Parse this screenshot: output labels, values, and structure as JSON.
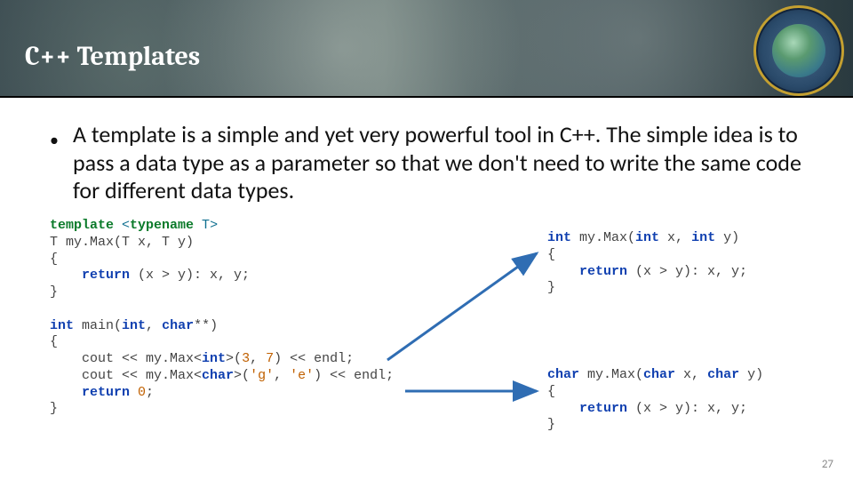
{
  "header": {
    "title": "C++ Templates"
  },
  "bullet": {
    "text": "A template is a simple and yet very powerful tool in C++. The simple idea is to pass a data type as a parameter so that we don't need to write the same code for different data types."
  },
  "code": {
    "left": {
      "l1a": "template ",
      "l1b": "<",
      "l1c": "typename ",
      "l1d": "T",
      "l1e": ">",
      "l2a": "T ",
      "l2b": "my.Max",
      "l2c": "(T x, T y)",
      "l3": "{",
      "l4a": "    return ",
      "l4b": "(x > y): x, y;",
      "l5": "}",
      "blank1": "",
      "l6a": "int ",
      "l6b": "main(",
      "l6c": "int",
      "l6d": ", ",
      "l6e": "char",
      "l6f": "**)",
      "l7": "{",
      "l8a": "    cout << my.Max<",
      "l8b": "int",
      "l8c": ">(",
      "l8d": "3",
      "l8e": ", ",
      "l8f": "7",
      "l8g": ") << endl;",
      "l9a": "    cout << my.Max<",
      "l9b": "char",
      "l9c": ">(",
      "l9d": "'g'",
      "l9e": ", ",
      "l9f": "'e'",
      "l9g": ") << endl;",
      "l10a": "    return ",
      "l10b": "0",
      "l10c": ";",
      "l11": "}"
    },
    "right_top": {
      "l1a": "int ",
      "l1b": "my.Max(",
      "l1c": "int ",
      "l1d": "x, ",
      "l1e": "int ",
      "l1f": "y)",
      "l2": "{",
      "l3a": "    return ",
      "l3b": "(x > y): x, y;",
      "l4": "}"
    },
    "right_bot": {
      "l1a": "char ",
      "l1b": "my.Max(",
      "l1c": "char ",
      "l1d": "x, ",
      "l1e": "char ",
      "l1f": "y)",
      "l2": "{",
      "l3a": "    return ",
      "l3b": "(x > y): x, y;",
      "l4": "}"
    }
  },
  "page": {
    "number": "27"
  },
  "colors": {
    "arrow": "#2f6db3"
  }
}
